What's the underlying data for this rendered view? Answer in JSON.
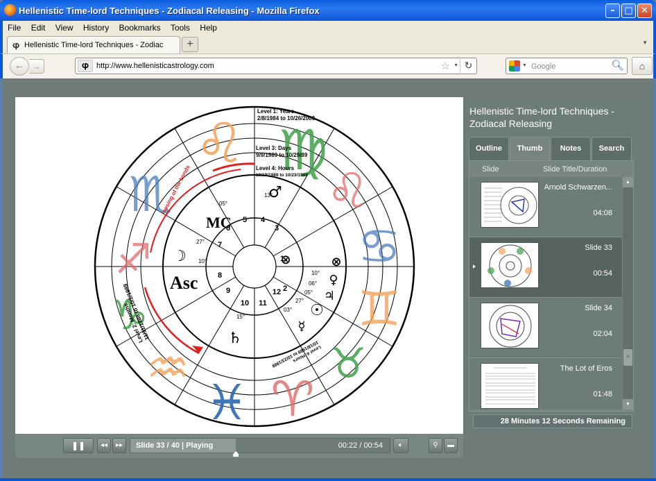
{
  "window": {
    "title": "Hellenistic Time-lord Techniques - Zodiacal Releasing - Mozilla Firefox",
    "minimize": "–",
    "maximize": "□",
    "close": "✕"
  },
  "menu": [
    "File",
    "Edit",
    "View",
    "History",
    "Bookmarks",
    "Tools",
    "Help"
  ],
  "tab": {
    "label": "Hellenistic Time-lord Techniques - Zodiacal R...",
    "new_tab": "+"
  },
  "nav": {
    "url": "http://www.hellenisticastrology.com",
    "search_placeholder": "Google"
  },
  "player": {
    "title": "Hellenistic Time-lord Techniques - Zodiacal Releasing",
    "tabs": [
      "Outline",
      "Thumb",
      "Notes",
      "Search"
    ],
    "active_tab": "Thumb",
    "list_header": {
      "slide": "Slide",
      "title_duration": "Slide Title/Duration"
    },
    "slides": [
      {
        "title": "Arnold Schwarzen...",
        "duration": "04:08",
        "selected": false
      },
      {
        "title": "Slide 33",
        "duration": "00:54",
        "selected": true
      },
      {
        "title": "Slide 34",
        "duration": "02:04",
        "selected": false
      },
      {
        "title": "The Lot of Eros",
        "duration": "01:48",
        "selected": false
      }
    ],
    "remaining": "28 Minutes 12 Seconds Remaining",
    "status": "Slide 33 / 40  |  Playing",
    "time": "00:22 / 00:54",
    "progress_fraction": 0.407
  },
  "chart": {
    "level1": "Level 1: Years",
    "level1_dates": "2/8/1984 to 10/26/2003",
    "level3": "Level 3: Days",
    "level3_dates": "9/9/1989 to 10/29/89",
    "level4": "Level 4: Hours",
    "level4_dates": "10/19/1989 to 10/23/1989",
    "loosing": "loosing of the bonds",
    "level2": "Level 2: Months",
    "level2_dates": "11/11/1988 to 10/2/1989",
    "level4b": "Level 4: Hours",
    "level4b_dates": "10/18/1989 to 10/23/1989",
    "mc": "MC",
    "asc": "Asc",
    "houses": [
      "1",
      "2",
      "3",
      "4",
      "5",
      "6",
      "7",
      "8",
      "9",
      "10",
      "11",
      "12"
    ],
    "degrees": [
      "13°",
      "05°",
      "27°",
      "10°",
      "15°",
      "27°",
      "03°",
      "10°",
      "06°",
      "05°"
    ]
  }
}
